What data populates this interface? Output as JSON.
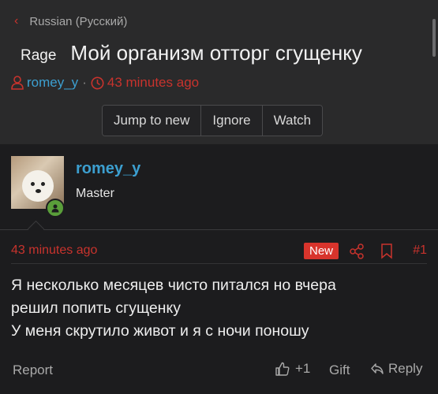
{
  "breadcrumb": {
    "label": "Russian (Русский)"
  },
  "thread": {
    "prefix": "Rage",
    "title": "Мой организм отторг сгущенку",
    "author": "romey_y",
    "separator": "·",
    "time": "43 minutes ago"
  },
  "actions": {
    "jump": "Jump to new",
    "ignore": "Ignore",
    "watch": "Watch"
  },
  "post": {
    "username": "romey_y",
    "rank": "Master",
    "time": "43 minutes ago",
    "badge": "New",
    "number": "#1",
    "lines": [
      "Я несколько месяцев чисто питался но вчера",
      "решил попить сгущенку",
      "У меня скрутило живот и я с ночи поношу"
    ]
  },
  "footer": {
    "report": "Report",
    "like_count": "+1",
    "gift": "Gift",
    "reply": "Reply"
  },
  "colors": {
    "accent_red": "#c8332d",
    "link_blue": "#3c9fd0",
    "online_green": "#5a9e3a"
  }
}
